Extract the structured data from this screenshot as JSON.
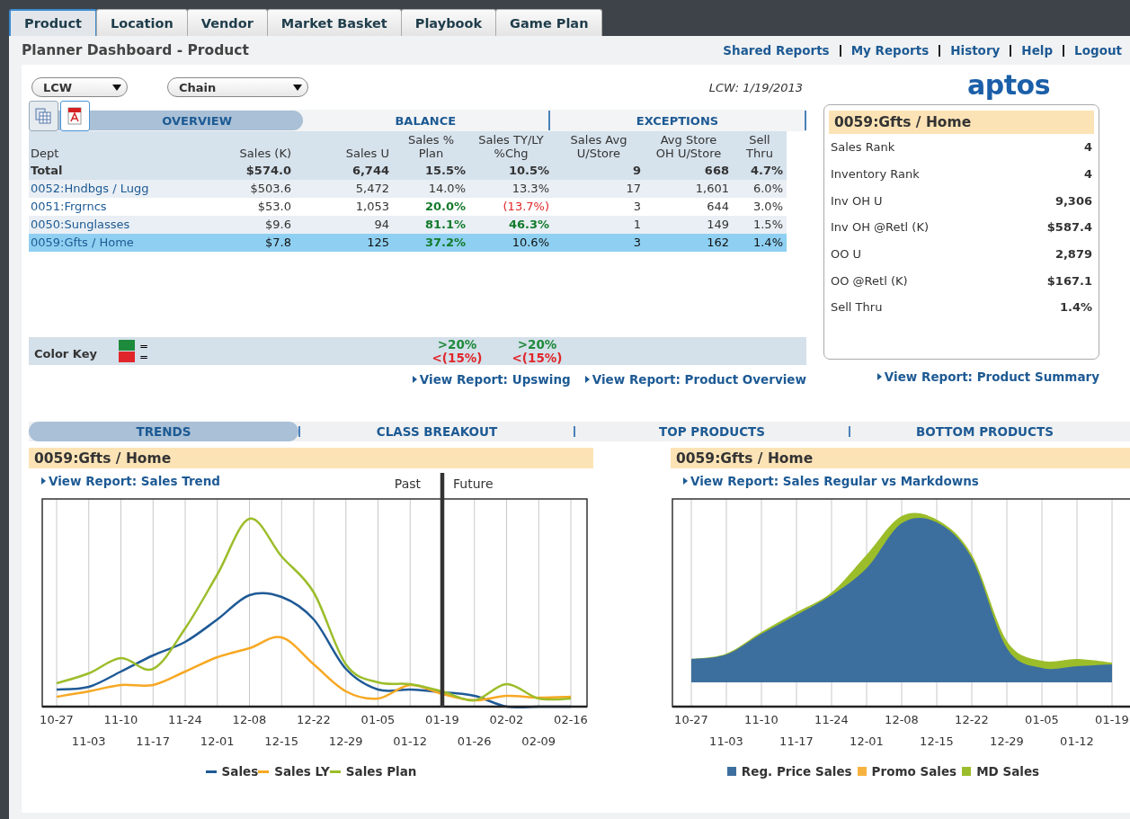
{
  "tabs": [
    {
      "label": "Product",
      "selected": true
    },
    {
      "label": "Location",
      "selected": false
    },
    {
      "label": "Vendor",
      "selected": false
    },
    {
      "label": "Market Basket",
      "selected": false
    },
    {
      "label": "Playbook",
      "selected": false
    },
    {
      "label": "Game Plan",
      "selected": false
    }
  ],
  "title": "Planner Dashboard - Product",
  "header_links": [
    "Shared Reports",
    "My Reports",
    "History",
    "Help",
    "Logout"
  ],
  "filters": [
    {
      "value": "LCW"
    },
    {
      "value": "Chain"
    }
  ],
  "date_label": "LCW: 1/19/2013",
  "logo": "aptos",
  "table_tabs": [
    {
      "label": "OVERVIEW",
      "selected": true
    },
    {
      "label": "BALANCE",
      "selected": false
    },
    {
      "label": "EXCEPTIONS",
      "selected": false
    }
  ],
  "table": {
    "columns": [
      "Dept",
      "Sales (K)",
      "Sales U",
      "Sales %\nPlan",
      "Sales TY/LY\n%Chg",
      "Sales Avg\nU/Store",
      "Avg Store\nOH U/Store",
      "Sell\nThru"
    ],
    "rows": [
      {
        "kind": "total",
        "selected": false,
        "cells": [
          "Total",
          "$574.0",
          "6,744",
          "15.5%",
          "10.5%",
          "9",
          "668",
          "4.7%"
        ]
      },
      {
        "kind": "dept",
        "selected": false,
        "cells": [
          "0052:Hndbgs / Lugg",
          "$503.6",
          "5,472",
          "14.0%",
          "13.3%",
          "17",
          "1,601",
          "6.0%"
        ]
      },
      {
        "kind": "dept",
        "selected": false,
        "cells": [
          "0051:Frgrncs",
          "$53.0",
          "1,053",
          {
            "text": "20.0%",
            "color": "#137a2c"
          },
          {
            "text": "(13.7%)",
            "color": "#e0262a"
          },
          "3",
          "644",
          "3.0%"
        ]
      },
      {
        "kind": "dept",
        "selected": false,
        "cells": [
          "0050:Sunglasses",
          "$9.6",
          "94",
          {
            "text": "81.1%",
            "color": "#137a2c"
          },
          {
            "text": "46.3%",
            "color": "#137a2c"
          },
          "1",
          "149",
          "1.5%"
        ]
      },
      {
        "kind": "dept",
        "selected": true,
        "cells": [
          "0059:Gfts / Home",
          "$7.8",
          "125",
          {
            "text": "37.2%",
            "color": "#137a2c"
          },
          "10.6%",
          "3",
          "162",
          "1.4%"
        ]
      }
    ]
  },
  "color_key": {
    "label": "Color Key",
    "items": [
      {
        "color": "#1e8a3c",
        "text": "="
      },
      {
        "color": "#e0262a",
        "text": "="
      }
    ],
    "thresholds": [
      {
        "good": ">20%",
        "bad": "<(15%)"
      },
      {
        "good": ">20%",
        "bad": "<(15%)"
      }
    ]
  },
  "report_links": [
    "View Report: Upswing",
    "View Report: Product Overview"
  ],
  "summary": {
    "title": "0059:Gfts / Home",
    "rows": [
      {
        "label": "Sales Rank",
        "value": "4"
      },
      {
        "label": "Inventory Rank",
        "value": "4"
      },
      {
        "label": "Inv OH U",
        "value": "9,306"
      },
      {
        "label": "Inv OH @Retl (K)",
        "value": "$587.4"
      },
      {
        "label": "OO U",
        "value": "2,879"
      },
      {
        "label": "OO @Retl (K)",
        "value": "$167.1"
      },
      {
        "label": "Sell Thru",
        "value": "1.4%"
      }
    ],
    "link": "View Report: Product Summary"
  },
  "bottom_tabs": [
    {
      "label": "TRENDS",
      "selected": true
    },
    {
      "label": "CLASS BREAKOUT",
      "selected": false
    },
    {
      "label": "TOP PRODUCTS",
      "selected": false
    },
    {
      "label": "BOTTOM PRODUCTS",
      "selected": false
    }
  ],
  "trend_chart": {
    "title": "0059:Gfts / Home",
    "link": "View Report: Sales Trend",
    "past_label": "Past",
    "future_label": "Future",
    "x_labels": [
      "10-27",
      "11-03",
      "11-10",
      "11-17",
      "11-24",
      "12-01",
      "12-08",
      "12-15",
      "12-22",
      "12-29",
      "01-05",
      "01-12",
      "01-19",
      "01-26",
      "02-02",
      "02-09",
      "02-16"
    ],
    "legend": [
      {
        "name": "Sales",
        "color": "#1f5a96"
      },
      {
        "name": "Sales LY",
        "color": "#f7a823"
      },
      {
        "name": "Sales Plan",
        "color": "#9cbd2a"
      }
    ]
  },
  "markdown_chart": {
    "title": "0059:Gfts / Home",
    "link": "View Report: Sales Regular vs Markdowns",
    "x_labels": [
      "10-27",
      "11-03",
      "11-10",
      "11-17",
      "11-24",
      "12-01",
      "12-08",
      "12-15",
      "12-22",
      "12-29",
      "01-05",
      "01-12",
      "01-19"
    ],
    "legend": [
      {
        "name": "Reg. Price Sales",
        "color": "#3d6f9e"
      },
      {
        "name": "Promo Sales",
        "color": "#f7b240"
      },
      {
        "name": "MD Sales",
        "color": "#9cbd2a"
      }
    ]
  }
}
